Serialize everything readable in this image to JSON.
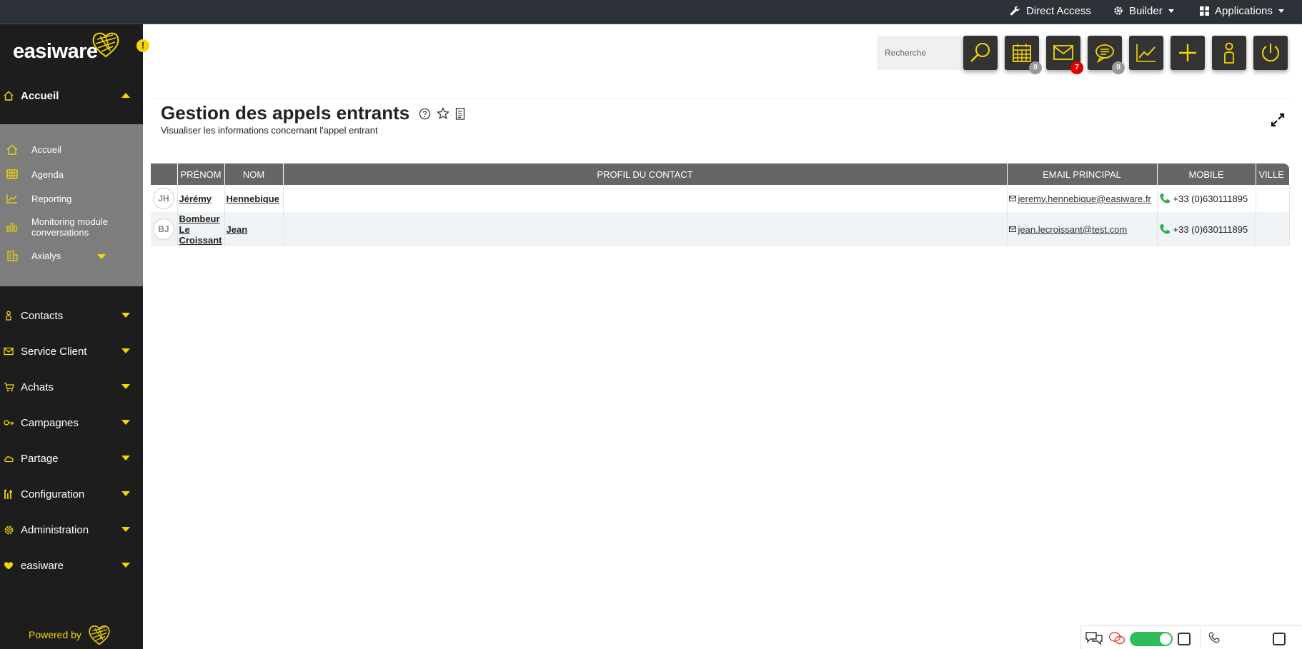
{
  "topbar": {
    "direct_access": "Direct Access",
    "builder": "Builder",
    "applications": "Applications"
  },
  "brand": {
    "name": "easiware",
    "accent_color": "#f5d600",
    "notif_symbol": "!",
    "powered_by": "Powered by"
  },
  "sidebar": {
    "sections": [
      {
        "label": "Accueil",
        "icon": "home-icon",
        "expanded": true
      },
      {
        "label": "Contacts",
        "icon": "person-icon"
      },
      {
        "label": "Service Client",
        "icon": "mail-icon"
      },
      {
        "label": "Achats",
        "icon": "cart-icon"
      },
      {
        "label": "Campagnes",
        "icon": "key-icon"
      },
      {
        "label": "Partage",
        "icon": "cloud-icon"
      },
      {
        "label": "Configuration",
        "icon": "tools-icon"
      },
      {
        "label": "Administration",
        "icon": "gear-icon"
      },
      {
        "label": "easiware",
        "icon": "heart-icon"
      }
    ],
    "submenu": [
      {
        "label": "Accueil",
        "icon": "home-icon"
      },
      {
        "label": "Agenda",
        "icon": "calendar-icon"
      },
      {
        "label": "Reporting",
        "icon": "chart-icon"
      },
      {
        "label": "Monitoring module conversations",
        "icon": "bars-icon"
      },
      {
        "label": "Axialys",
        "icon": "building-icon"
      }
    ]
  },
  "header": {
    "search_placeholder": "Recherche",
    "badges": {
      "calendar": "0",
      "mail": "7",
      "chat": "0"
    }
  },
  "page": {
    "title": "Gestion des appels entrants",
    "subtitle": "Visualiser les informations concernant l'appel entrant"
  },
  "table": {
    "columns": [
      "",
      "PRÉNOM",
      "NOM",
      "PROFIL DU CONTACT",
      "EMAIL PRINCIPAL",
      "MOBILE",
      "VILLE"
    ],
    "rows": [
      {
        "initials": "JH",
        "prenom": "Jérémy",
        "nom": "Hennebique",
        "profil": "",
        "email": "jeremy.hennebique@easiware.fr",
        "mobile": "+33 (0)630111895",
        "ville": ""
      },
      {
        "initials": "BJ",
        "prenom": "Bombeur Le Croissant",
        "nom": "Jean",
        "profil": "",
        "email": "jean.lecroissant@test.com",
        "mobile": "+33 (0)630111895",
        "ville": ""
      }
    ]
  },
  "colors": {
    "sidebar_bg": "#1d1d1d",
    "submenu_bg": "#7d7d7d",
    "table_header_bg": "#666666",
    "tool_button_bg": "#333333",
    "toggle_on": "#2ebd59",
    "badge_red": "#e60000"
  }
}
